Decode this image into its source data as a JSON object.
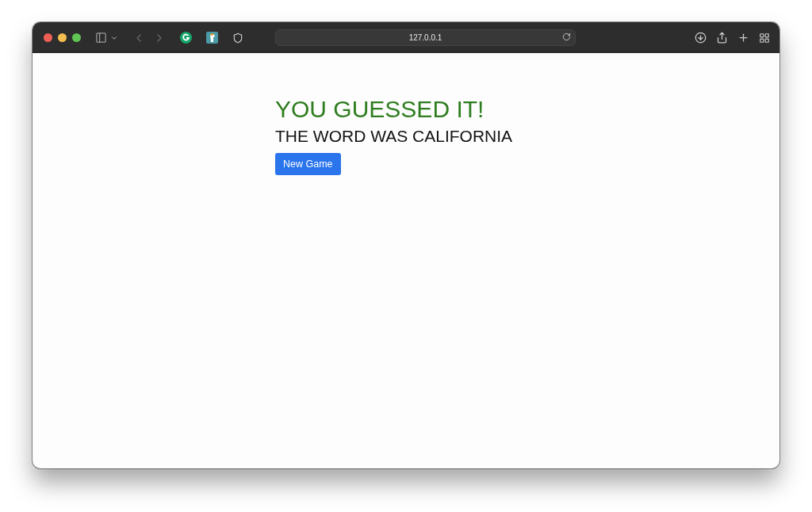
{
  "browser": {
    "address": "127.0.0.1"
  },
  "page": {
    "title": "YOU GUESSED IT!",
    "subtitle": "THE WORD WAS CALIFORNIA",
    "button": "New Game"
  }
}
